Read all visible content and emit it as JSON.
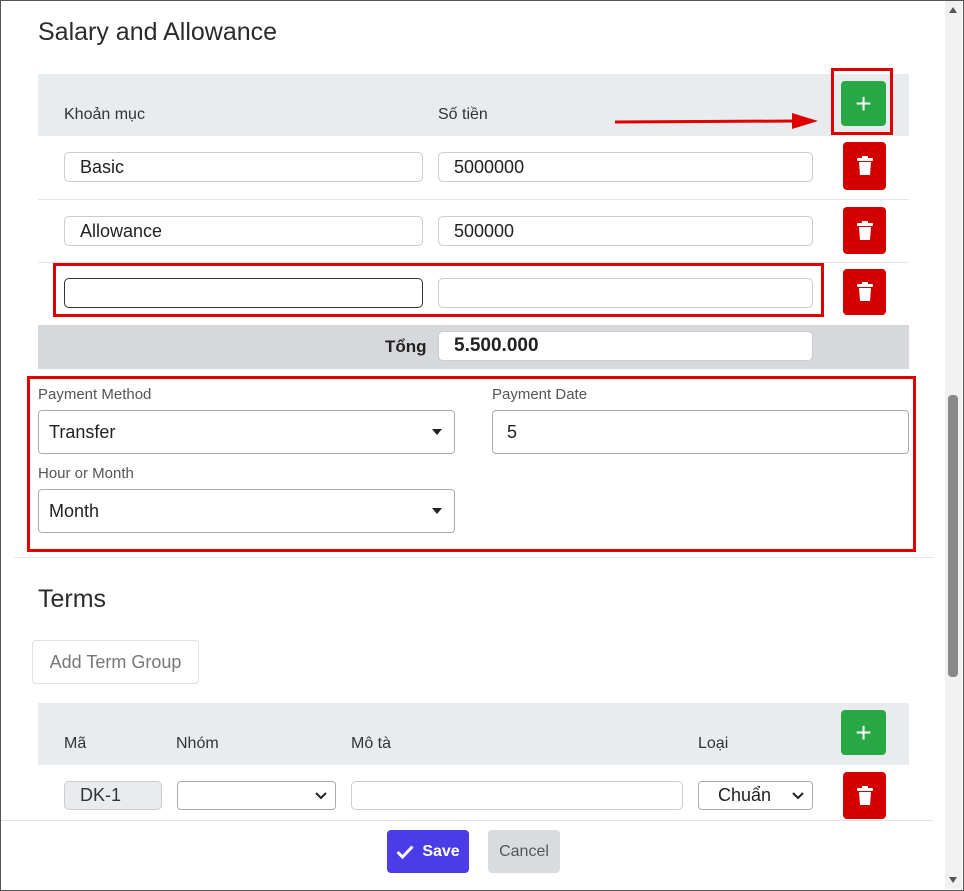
{
  "salary": {
    "title": "Salary and Allowance",
    "col_item": "Khoản mục",
    "col_amount": "Số tiền",
    "rows": [
      {
        "item": "Basic",
        "amount": "5000000"
      },
      {
        "item": "Allowance",
        "amount": "500000"
      },
      {
        "item": "",
        "amount": ""
      }
    ],
    "total_label": "Tổng",
    "total_value": "5.500.000",
    "add_icon": "plus-icon",
    "delete_icon": "trash-icon"
  },
  "payment": {
    "method_label": "Payment Method",
    "method_value": "Transfer",
    "date_label": "Payment Date",
    "date_value": "5",
    "period_label": "Hour or Month",
    "period_value": "Month"
  },
  "terms": {
    "title": "Terms",
    "add_group_label": "Add Term Group",
    "col_code": "Mã",
    "col_group": "Nhóm",
    "col_desc": "Mô tà",
    "col_type": "Loại",
    "rows": [
      {
        "code": "DK-1",
        "group": "",
        "desc": "",
        "type": "Chuẩn"
      }
    ]
  },
  "footer": {
    "save_label": "Save",
    "cancel_label": "Cancel"
  },
  "colors": {
    "accent_green": "#28a745",
    "danger_red": "#d30000",
    "annotation_red": "#e00000",
    "primary": "#4a3de8"
  }
}
